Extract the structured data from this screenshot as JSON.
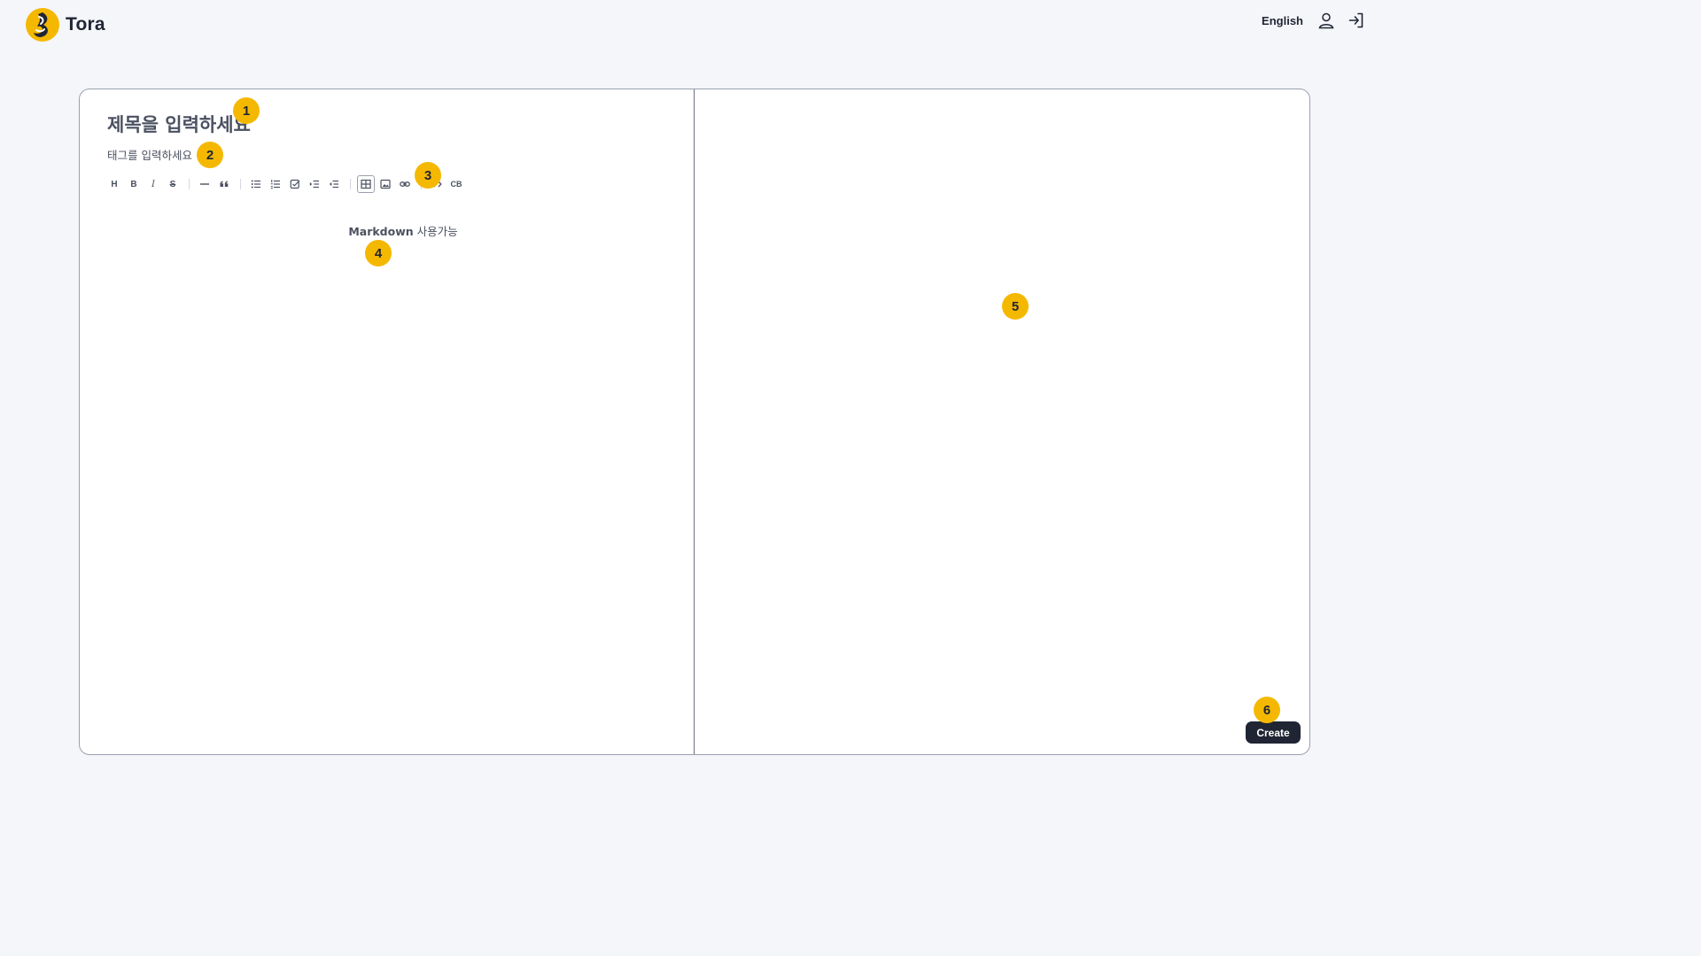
{
  "brand": {
    "name": "Tora",
    "logo_icon": "tora-logo-icon"
  },
  "header": {
    "language": "English",
    "icons": [
      "user-icon",
      "login-icon"
    ]
  },
  "editor": {
    "title_placeholder": "제목을 입력하세요",
    "tags_placeholder": "태그를 입력하세요",
    "toolbar": [
      "heading",
      "bold",
      "italic",
      "strike",
      "hr",
      "quote",
      "bullet-list",
      "ordered-list",
      "task-list",
      "indent",
      "outdent",
      "table",
      "image",
      "link",
      "code",
      "code-block"
    ],
    "toolbar_labels": {
      "heading": "H",
      "bold": "B",
      "italic": "I",
      "strike": "S",
      "code_block": "CB"
    },
    "hint_bold": "Markdown",
    "hint_rest": " 사용가능"
  },
  "actions": {
    "create_label": "Create"
  },
  "markers": [
    "1",
    "2",
    "3",
    "4",
    "5",
    "6"
  ],
  "colors": {
    "page_background": "#f5f6fa",
    "primary_dark": "#1f2533",
    "marker_yellow": "#f5b800",
    "logo_yellow": "#f5b800"
  }
}
